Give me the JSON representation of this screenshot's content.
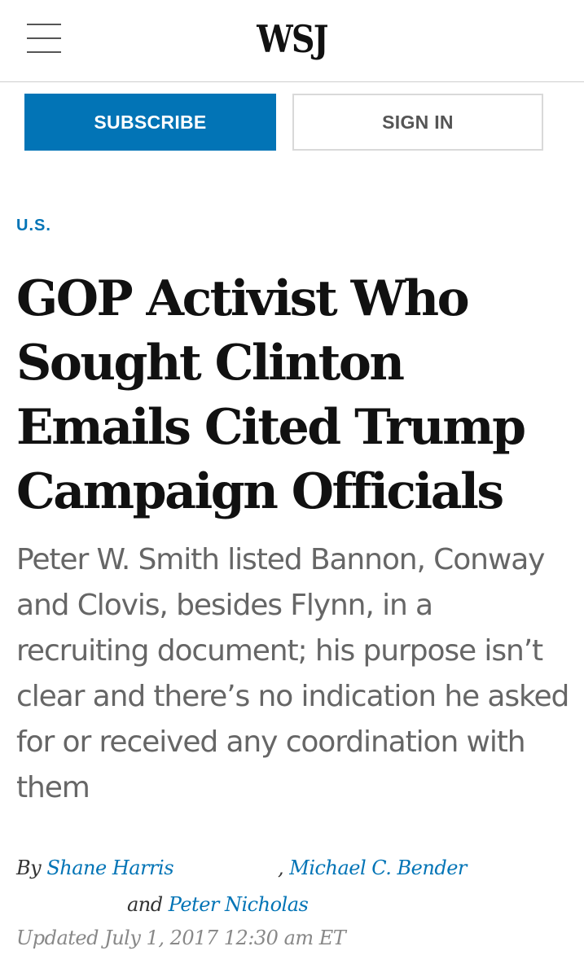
{
  "header": {
    "logo": "WSJ",
    "menu_icon": "hamburger-menu-icon"
  },
  "account": {
    "subscribe_label": "SUBSCRIBE",
    "signin_label": "SIGN IN"
  },
  "article": {
    "section": "U.S.",
    "headline": "GOP Activist Who Sought Clinton Emails Cited Trump Campaign Officials",
    "dek": "Peter W. Smith listed Bannon, Conway and Clovis, besides Flynn, in a recruiting document; his purpose isn’t clear and there’s no indication he asked for or received any coordination with them",
    "byline": {
      "prefix": "By",
      "authors": [
        "Shane Harris",
        "Michael C. Bender",
        "Peter Nicholas"
      ],
      "separator": ",",
      "conjunction": "and"
    },
    "updated": "Updated July 1, 2017 12:30 am ET"
  },
  "colors": {
    "accent": "#0274b6",
    "headline": "#111111",
    "dek": "#666666",
    "timestamp": "#888888"
  }
}
